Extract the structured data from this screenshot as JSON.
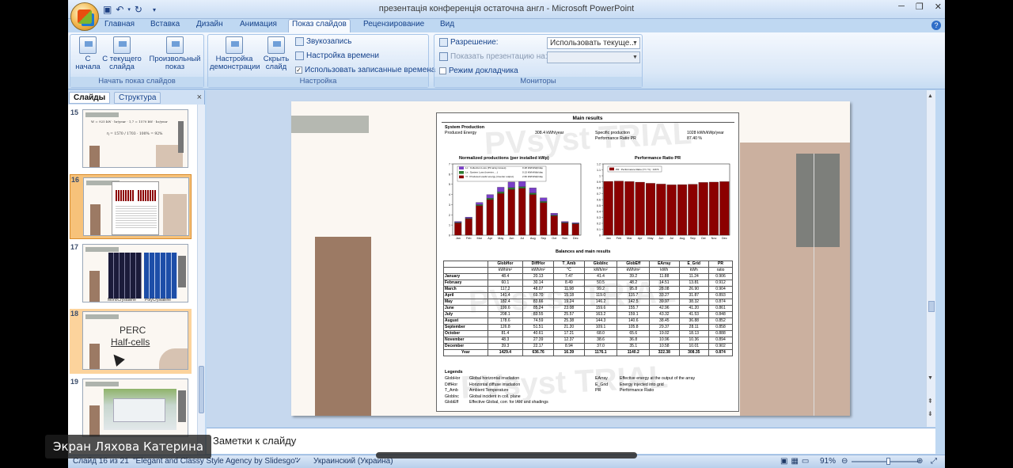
{
  "window": {
    "title": "презентація конференція остаточна  англ  -  Microsoft PowerPoint"
  },
  "tabs": [
    "Главная",
    "Вставка",
    "Дизайн",
    "Анимация",
    "Показ слайдов",
    "Рецензирование",
    "Вид"
  ],
  "active_tab": "Показ слайдов",
  "ribbon": {
    "groups": {
      "start_show": {
        "label": "Начать показ слайдов",
        "from_start": "С начала",
        "from_current": "С текущего слайда",
        "custom_show": "Произвольный показ"
      },
      "setup": {
        "label": "Настройка",
        "setup_show": "Настройка демонстрации",
        "hide_slide": "Скрыть слайд",
        "record_narration": "Звукозапись",
        "rehearse_timings": "Настройка времени",
        "use_timings": "Использовать записанные времена"
      },
      "monitors": {
        "label": "Мониторы",
        "resolution_label": "Разрешение:",
        "resolution_value": "Использовать текуще...",
        "show_on_label": "Показать презентацию на:",
        "presenter_view": "Режим докладчика"
      }
    }
  },
  "left_panel": {
    "tab_slides": "Слайды",
    "tab_outline": "Структура",
    "close": "×",
    "thumbnails": [
      {
        "num": "15",
        "formula_line1": "W",
        "formula_text": "= 925 kW · hr/year · 1,7 = 1570 kW · hr/year",
        "eta": "η = 1570 / 1703 · 100% = 92%"
      },
      {
        "num": "16"
      },
      {
        "num": "17",
        "label_left": "MonoCrystalline",
        "label_right": "PolyCrystalline"
      },
      {
        "num": "18",
        "line1": "PERC",
        "line2": "Half-cells"
      },
      {
        "num": "19"
      }
    ]
  },
  "slide": {
    "sheet": {
      "title": "Main results",
      "system_production": "System Production",
      "produced_energy_label": "Produced Energy",
      "produced_energy_value": "308.4 kWh/year",
      "specific_label": "Specific production",
      "specific_value": "1028 kWh/kWp/year",
      "pr_label": "Performance Ratio PR",
      "pr_value": "87.40 %",
      "chart1_title": "Normalized productions (per installed kWp)",
      "chart2_title": "Performance Ratio PR",
      "chart1_legend": [
        {
          "label": "Lc : Collection Loss (PV-array losses)",
          "value": "0.28 kWh/kWp/day",
          "color": "#7a3fc8"
        },
        {
          "label": "Ls : System Loss (inverter, ...)",
          "value": "0.13 kWh/kWp/day",
          "color": "#2e7d32"
        },
        {
          "label": "Yf : Produced useful energy  (inverter output)",
          "value": "2.82 kWh/kWp/day",
          "color": "#8b0000"
        }
      ],
      "chart2_legend": "PR : Performance Ratio (Yf / Yr) :  0.874",
      "balances_title": "Balances and main results",
      "legends_title": "Legends",
      "legend_rows": [
        [
          "GlobHor",
          "Global horizontal irradiation",
          "EArray",
          "Effective energy at the output of the array"
        ],
        [
          "DiffHor",
          "Horizontal diffuse irradiation",
          "E_Grid",
          "Energy injected into grid"
        ],
        [
          "T_Amb",
          "Ambient Temperature",
          "PR",
          "Performance Ratio"
        ],
        [
          "GlobInc",
          "Global incident in coll. plane",
          "",
          ""
        ],
        [
          "GlobEff",
          "Effective Global, corr. for IAM and shadings",
          "",
          ""
        ]
      ],
      "watermark": "PVsyst TRIAL"
    },
    "balances_table": {
      "headers": [
        "",
        "GlobHor",
        "DiffHor",
        "T_Amb",
        "GlobInc",
        "GlobEff",
        "EArray",
        "E_Grid",
        "PR"
      ],
      "units": [
        "",
        "kWh/m²",
        "kWh/m²",
        "°C",
        "kWh/m²",
        "kWh/m²",
        "kWh",
        "kWh",
        "ratio"
      ],
      "rows": [
        [
          "January",
          "48.4",
          "20.13",
          "7.47",
          "41.4",
          "39.2",
          "11.88",
          "11.24",
          "0.906"
        ],
        [
          "February",
          "60.1",
          "30.14",
          "8.49",
          "50.5",
          "48.2",
          "14.51",
          "13.81",
          "0.912"
        ],
        [
          "March",
          "117.2",
          "48.07",
          "11.98",
          "99.2",
          "95.8",
          "28.08",
          "26.90",
          "0.904"
        ],
        [
          "April",
          "141.4",
          "69.70",
          "15.18",
          "119.0",
          "115.7",
          "33.27",
          "31.87",
          "0.893"
        ],
        [
          "May",
          "182.4",
          "83.66",
          "19.24",
          "146.2",
          "142.5",
          "39.97",
          "38.32",
          "0.874"
        ],
        [
          "June",
          "199.6",
          "85.24",
          "23.08",
          "159.6",
          "155.7",
          "42.96",
          "41.20",
          "0.861"
        ],
        [
          "July",
          "208.1",
          "83.55",
          "25.57",
          "163.2",
          "159.1",
          "43.32",
          "41.53",
          "0.848"
        ],
        [
          "August",
          "178.6",
          "74.59",
          "25.38",
          "144.3",
          "140.6",
          "38.45",
          "36.88",
          "0.852"
        ],
        [
          "September",
          "126.8",
          "51.51",
          "21.20",
          "109.1",
          "105.8",
          "29.37",
          "28.11",
          "0.858"
        ],
        [
          "October",
          "81.4",
          "40.61",
          "17.21",
          "68.0",
          "65.6",
          "19.02",
          "18.13",
          "0.888"
        ],
        [
          "November",
          "48.3",
          "27.39",
          "12.37",
          "38.6",
          "36.8",
          "10.96",
          "10.36",
          "0.894"
        ],
        [
          "December",
          "39.3",
          "22.17",
          "8.94",
          "37.0",
          "35.1",
          "10.58",
          "10.01",
          "0.902"
        ]
      ],
      "year": [
        "Year",
        "1429.4",
        "636.76",
        "16.39",
        "1176.1",
        "1140.2",
        "322.38",
        "308.35",
        "0.874"
      ]
    }
  },
  "chart_data": [
    {
      "type": "bar",
      "title": "Normalized productions (per installed kWp)",
      "categories": [
        "Jan",
        "Feb",
        "Mar",
        "Apr",
        "May",
        "Jun",
        "Jul",
        "Aug",
        "Sep",
        "Oct",
        "Nov",
        "Dec"
      ],
      "ylim": [
        0,
        7
      ],
      "stacked": true,
      "series": [
        {
          "name": "Yf : Produced useful energy  (inverter output)",
          "values": [
            1.2,
            1.6,
            2.9,
            3.5,
            4.1,
            4.5,
            4.6,
            4.0,
            3.2,
            1.9,
            1.2,
            1.1
          ],
          "color": "#8b0000"
        },
        {
          "name": "Ls : System Loss (inverter, ...)",
          "values": [
            0.05,
            0.06,
            0.1,
            0.14,
            0.16,
            0.17,
            0.17,
            0.15,
            0.12,
            0.08,
            0.05,
            0.05
          ],
          "color": "#2e7d32"
        },
        {
          "name": "Lc : Collection Loss (PV-array losses)",
          "values": [
            0.1,
            0.12,
            0.22,
            0.35,
            0.45,
            0.55,
            0.6,
            0.5,
            0.35,
            0.18,
            0.1,
            0.08
          ],
          "color": "#7a3fc8"
        }
      ]
    },
    {
      "type": "bar",
      "title": "Performance Ratio PR",
      "categories": [
        "Jan",
        "Feb",
        "Mar",
        "Apr",
        "May",
        "Jun",
        "Jul",
        "Aug",
        "Sep",
        "Oct",
        "Nov",
        "Dec"
      ],
      "ylim": [
        0,
        1.2
      ],
      "series": [
        {
          "name": "PR : Performance Ratio (Yf / Yr) :  0.874",
          "values": [
            0.906,
            0.912,
            0.904,
            0.893,
            0.874,
            0.861,
            0.848,
            0.852,
            0.858,
            0.888,
            0.894,
            0.902
          ],
          "color": "#8b0000"
        }
      ]
    }
  ],
  "notes": {
    "placeholder": "Заметки к слайду"
  },
  "status_bar": {
    "slide_info": "Слайд 16 из 21",
    "theme": "\"Elegant and Classy Style Agency by Slidesgo\"",
    "language": "Украинский (Украина)",
    "zoom": "91%"
  },
  "overlay": {
    "participant_name": "Экран Ляхова Катерина"
  }
}
